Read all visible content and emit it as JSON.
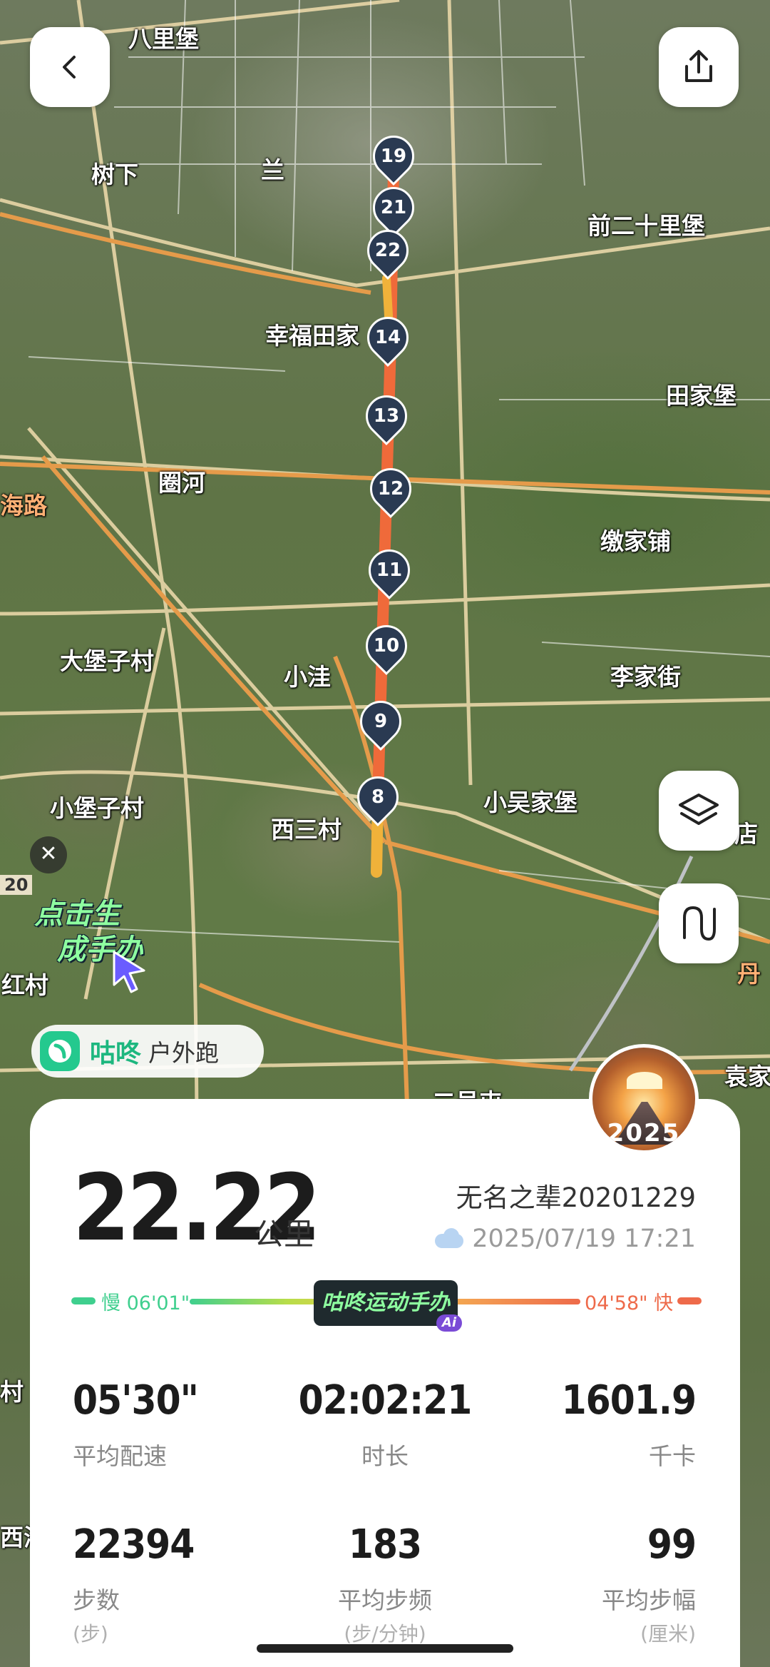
{
  "map": {
    "places": [
      {
        "name": "八里堡"
      },
      {
        "name": "树下"
      },
      {
        "name": "兰"
      },
      {
        "name": "前二十里堡"
      },
      {
        "name": "幸福田家"
      },
      {
        "name": "田家堡"
      },
      {
        "name": "圈河"
      },
      {
        "name": "海路"
      },
      {
        "name": "缴家铺"
      },
      {
        "name": "大堡子村"
      },
      {
        "name": "小洼"
      },
      {
        "name": "李家街"
      },
      {
        "name": "小堡子村"
      },
      {
        "name": "西三村"
      },
      {
        "name": "小吴家堡"
      },
      {
        "name": "红村"
      },
      {
        "name": "袁家"
      },
      {
        "name": "二号屯"
      },
      {
        "name": "丹"
      },
      {
        "name": "店"
      },
      {
        "name": "20"
      },
      {
        "name": "村"
      },
      {
        "name": "西海"
      }
    ],
    "km_markers": [
      "19",
      "21",
      "22",
      "14",
      "13",
      "12",
      "11",
      "10",
      "9",
      "8"
    ],
    "route_colors": {
      "slow": "#f0b23a",
      "fast": "#ef6a3a"
    }
  },
  "controls": {
    "back_icon": "chevron-left-icon",
    "share_icon": "share-icon",
    "layers_icon": "layers-icon",
    "route_icon": "route-icon",
    "close_icon": "close-icon"
  },
  "promo": {
    "line1": "点击生",
    "line2": "成手办"
  },
  "brand": {
    "name": "咕咚",
    "subtitle": "户外跑"
  },
  "avatar": {
    "text": "2025"
  },
  "summary": {
    "distance": "22.22",
    "distance_unit": "公里",
    "username": "无名之辈20201229",
    "datetime": "2025/07/19 17:21",
    "pace_slow_label": "慢 06'01\"",
    "pace_fast_label": "04'58\" 快",
    "badge": "咕咚运动手办",
    "badge_ai": "Ai"
  },
  "stats": [
    {
      "value": "05'30\"",
      "label": "平均配速",
      "sub": ""
    },
    {
      "value": "02:02:21",
      "label": "时长",
      "sub": ""
    },
    {
      "value": "1601.9",
      "label": "千卡",
      "sub": ""
    },
    {
      "value": "22394",
      "label": "步数",
      "sub": "(步)"
    },
    {
      "value": "183",
      "label": "平均步频",
      "sub": "(步/分钟)"
    },
    {
      "value": "99",
      "label": "平均步幅",
      "sub": "(厘米)"
    }
  ]
}
